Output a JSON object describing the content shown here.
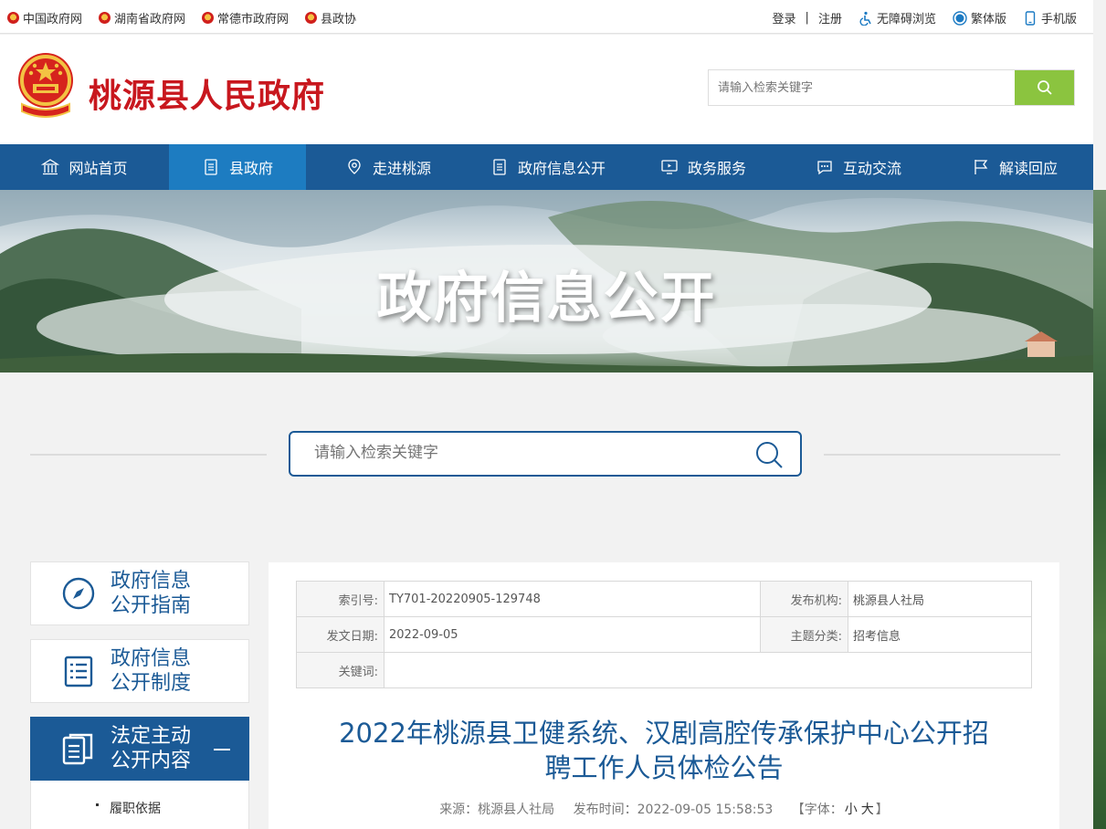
{
  "topbar": {
    "links": [
      "中国政府网",
      "湖南省政府网",
      "常德市政府网",
      "县政协"
    ],
    "login": "登录",
    "register": "注册",
    "accessible": "无障碍浏览",
    "traditional": "繁体版",
    "mobile": "手机版"
  },
  "header": {
    "site_title": "桃源县人民政府",
    "search_placeholder": "请输入检索关键字"
  },
  "nav": {
    "items": [
      "网站首页",
      "县政府",
      "走进桃源",
      "政府信息公开",
      "政务服务",
      "互动交流",
      "解读回应"
    ],
    "active_index": 1
  },
  "banner": {
    "title": "政府信息公开"
  },
  "bigsearch": {
    "placeholder": "请输入检索关键字"
  },
  "leftmenu": {
    "items": [
      {
        "label_line1": "政府信息",
        "label_line2": "公开指南",
        "icon": "compass-icon"
      },
      {
        "label_line1": "政府信息",
        "label_line2": "公开制度",
        "icon": "document-list-icon"
      },
      {
        "label_line1": "法定主动",
        "label_line2": "公开内容",
        "icon": "documents-icon"
      }
    ],
    "sub_item": "履职依据"
  },
  "meta": {
    "index_no_label": "索引号:",
    "index_no": "TY701-20220905-129748",
    "publisher_label": "发布机构:",
    "publisher": "桃源县人社局",
    "date_label": "发文日期:",
    "date": "2022-09-05",
    "topic_label": "主题分类:",
    "topic": "招考信息",
    "keywords_label": "关键词:",
    "keywords": ""
  },
  "article": {
    "title_line1": "2022年桃源县卫健系统、汉剧高腔传承保护中心公开招",
    "title_line2": "聘工作人员体检公告",
    "source": "来源：桃源县人社局",
    "publish_time": "发布时间：2022-09-05 15:58:53",
    "font_label_open": "【字体：",
    "font_small": "小",
    "font_large": "大",
    "font_label_close": "】"
  },
  "colors": {
    "nav_bg": "#1b5a96",
    "nav_active": "#1d7cc1",
    "title_red": "#c8171e",
    "search_green": "#8bc43f"
  }
}
